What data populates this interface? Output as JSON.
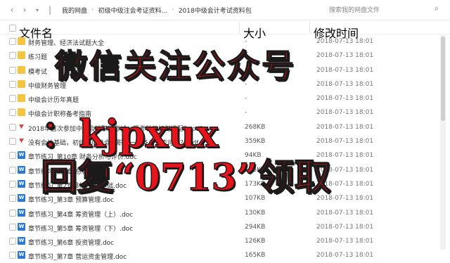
{
  "toolbar": {
    "breadcrumbs": [
      "我的网盘",
      "初级中级注会考证资料...",
      "2018中级会计考试资料包"
    ],
    "search_placeholder": "搜索我的网盘文件"
  },
  "columns": {
    "name": "文件名",
    "size": "大小",
    "modified": "修改时间"
  },
  "files": [
    {
      "icon": "folder-icon",
      "name": "财务管理、经济法试题大全",
      "size": "-",
      "time": "2018-07-13 18:01"
    },
    {
      "icon": "folder-icon",
      "name": "练习题",
      "size": "-",
      "time": "2018-07-13 18:01"
    },
    {
      "icon": "folder-icon",
      "name": "模考试",
      "size": "-",
      "time": "2018-07-13 18:01"
    },
    {
      "icon": "folder-icon",
      "name": "中级财务管理",
      "size": "-",
      "time": "2018-07-13 18:01"
    },
    {
      "icon": "folder-icon",
      "name": "中级会计历年真题",
      "size": "-",
      "time": "2018-07-13 18:01"
    },
    {
      "icon": "folder-icon",
      "name": "中级会计职称备考指南",
      "size": "-",
      "time": "2018-07-13 18:01"
    },
    {
      "icon": "pdf-icon",
      "name": "2018年首次参加中级会计职称考试，报考科目如何搭配？.pdf",
      "size": "268KB",
      "time": "2018-07-13 18:01"
    },
    {
      "icon": "pdf-icon",
      "name": "没有会计基础，初级和中级会计职称一起备考是否可行？.pdf",
      "size": "359KB",
      "time": "2018-07-13 18:01"
    },
    {
      "icon": "doc-icon",
      "name": "章节练习_第10章 财务分析与评价.doc",
      "size": "94KB",
      "time": "2018-07-13 18:01"
    },
    {
      "icon": "doc-icon",
      "name": "章节练习_第1章 总论.doc",
      "size": "115KB",
      "time": "2018-07-13 18:01"
    },
    {
      "icon": "doc-icon",
      "name": "章节练习_第2章 财务管理基础.doc",
      "size": "173KB",
      "time": "2018-07-13 18:01"
    },
    {
      "icon": "doc-icon",
      "name": "章节练习_第3章 预算管理.doc",
      "size": "107KB",
      "time": "2018-07-13 18:01"
    },
    {
      "icon": "doc-icon",
      "name": "章节练习_第4章 筹资管理（上）.doc",
      "size": "130KB",
      "time": "2018-07-13 18:01"
    },
    {
      "icon": "doc-icon",
      "name": "章节练习_第5章 筹资管理（下）.doc",
      "size": "294KB",
      "time": "2018-07-13 18:01"
    },
    {
      "icon": "doc-icon",
      "name": "章节练习_第6章 投资管理.doc",
      "size": "126KB",
      "time": "2018-07-13 18:01"
    },
    {
      "icon": "doc-icon",
      "name": "章节练习_第7章 营运资金管理.doc",
      "size": "165KB",
      "time": "2018-07-13 18:01"
    }
  ],
  "overlay": {
    "line1": "微信关注公众号",
    "line2": "：kjpxux",
    "line3": "回复“0713”领取"
  },
  "colors": {
    "overlay_red": "#e8141b",
    "folder": "#f5c542",
    "doc": "#2b79d6",
    "pdf": "#e03a3a"
  }
}
